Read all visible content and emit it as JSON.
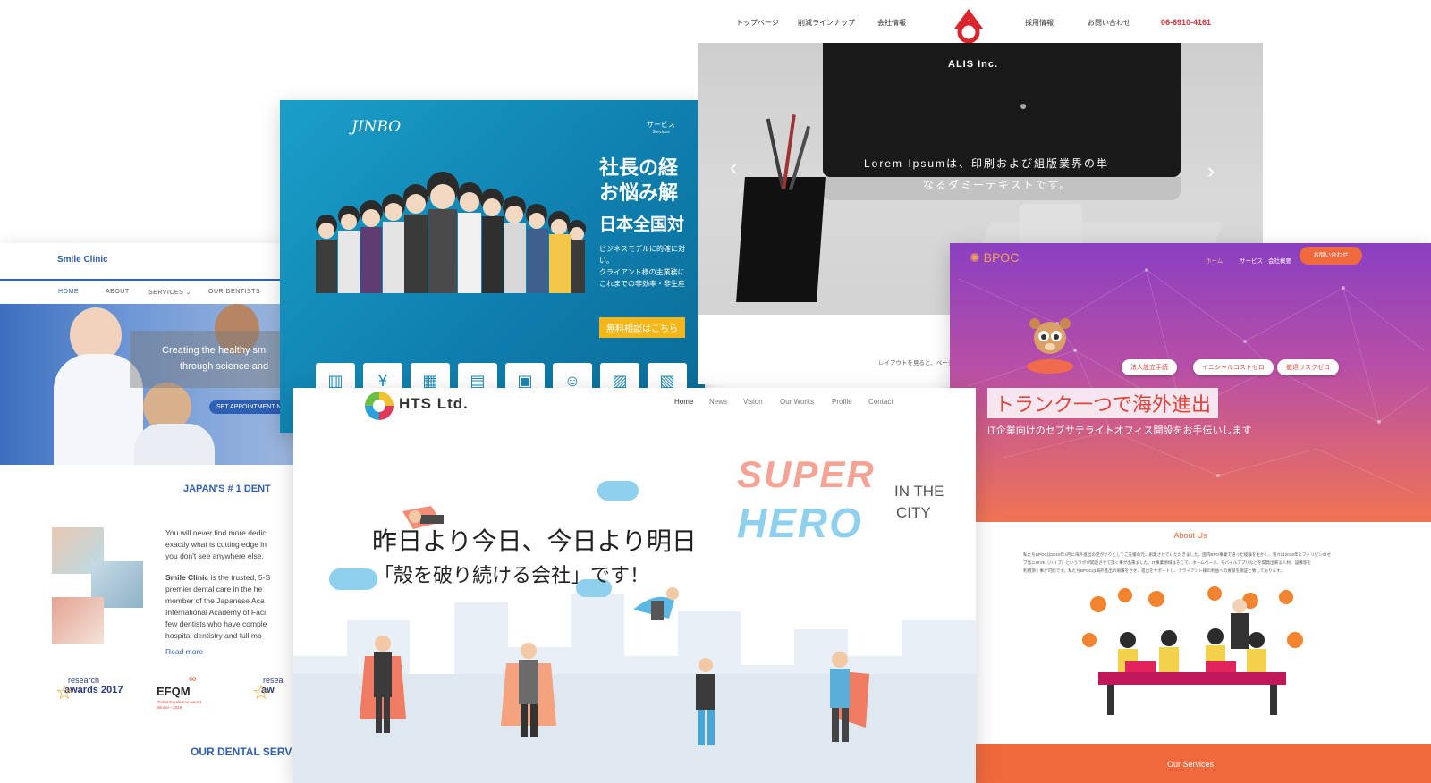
{
  "smile": {
    "brand": "Smile Clinic",
    "nav": [
      "HOME",
      "ABOUT",
      "SERVICES ⌄",
      "OUR DENTISTS"
    ],
    "hero_line1": "Creating the healthy sm",
    "hero_line2": "through science and",
    "cta": "SET APPOINTMENT N",
    "heading": "JAPAN'S # 1 DENT",
    "para": [
      "You will never find more dedic",
      "exactly what is cutting edge in",
      "you don't see anywhere else."
    ],
    "para2_brand": "Smile Clinic",
    "para2": [
      " is the trusted, 5-S",
      "premier dental care in the he",
      "member of the Japanese Aca",
      "International Academy of Faci",
      "few dentists who have comple",
      "hospital dentistry and full mo"
    ],
    "read_more": "Read more",
    "award1_top": "research",
    "award1_bottom": "awards 2017",
    "award2": "EFQM",
    "award2_sub1": "Global Excellence Award",
    "award2_sub2": "Winner - 2019",
    "award3_top": "resea",
    "award3_bottom": "aw",
    "services_heading": "OUR DENTAL SERV"
  },
  "jinbo": {
    "logo": "JINBO",
    "nav1": "サービス",
    "nav1_sub": "Services",
    "headline1": "社長の経",
    "headline2": "お悩み解",
    "sub_headline": "日本全国対",
    "body": [
      "ビジネスモデルに的確に対",
      "い。",
      "クライアント様の主業務に",
      "",
      "これまでの非効率・非生産"
    ],
    "cta": "無料相談はこちら"
  },
  "alis": {
    "nav": [
      "トップページ",
      "削減ラインナップ",
      "会社情報",
      "採用情報",
      "お問い合わせ"
    ],
    "phone": "06-6910-4161",
    "brand": "ALIS Inc.",
    "hero_line1": "Lorem Ipsumは、印刷および組版業界の単",
    "hero_line2": "なるダミーテキストです。",
    "footer_text": "レイアウトを見ると、ページの読"
  },
  "bpoc": {
    "logo": "BPOC",
    "nav": [
      "ホーム",
      "サービス",
      "会社概要"
    ],
    "contact": "お問い合わせ",
    "clouds": [
      "法人設立手続",
      "イニシャルコストゼロ",
      "撤退リスクゼロ"
    ],
    "headline": "トランク一つで海外進出",
    "sub": "IT企業向けのセブサテライトオフィス開設をお手伝いします",
    "about_heading": "About Us",
    "about_text": [
      "私たちBPOCは2018年4月に海外進出の足がかりとしてご支援の元、創業させていただきました。国内BPO事業で培った経験を生かし、我々は2019年にフィリピンのセ",
      "ブ島にHIVE（ハイブ）というラボが開設させて頂く事が出来ました。IT事業領域はそこで、ホームページ、モバイルアプリなどを開発出来る人材、設備等を",
      "利用頂く事が可能です。私たちBPOCは海外進出の飛躍をさせ、進出をサポートし、クライアント様の利益への貢献を保証と致しております。"
    ],
    "services_heading": "Our Services"
  },
  "hts": {
    "logo": "HTS Ltd.",
    "nav": [
      "Home",
      "News",
      "Vision",
      "Our Works",
      "Profile",
      "Contact"
    ],
    "headline": "昨日より今日、今日より明日",
    "sub": "「殻を破り続ける会社」です！",
    "art_super": "SUPER",
    "art_hero": "HERO",
    "art_in": "IN THE",
    "art_city": "CITY"
  }
}
